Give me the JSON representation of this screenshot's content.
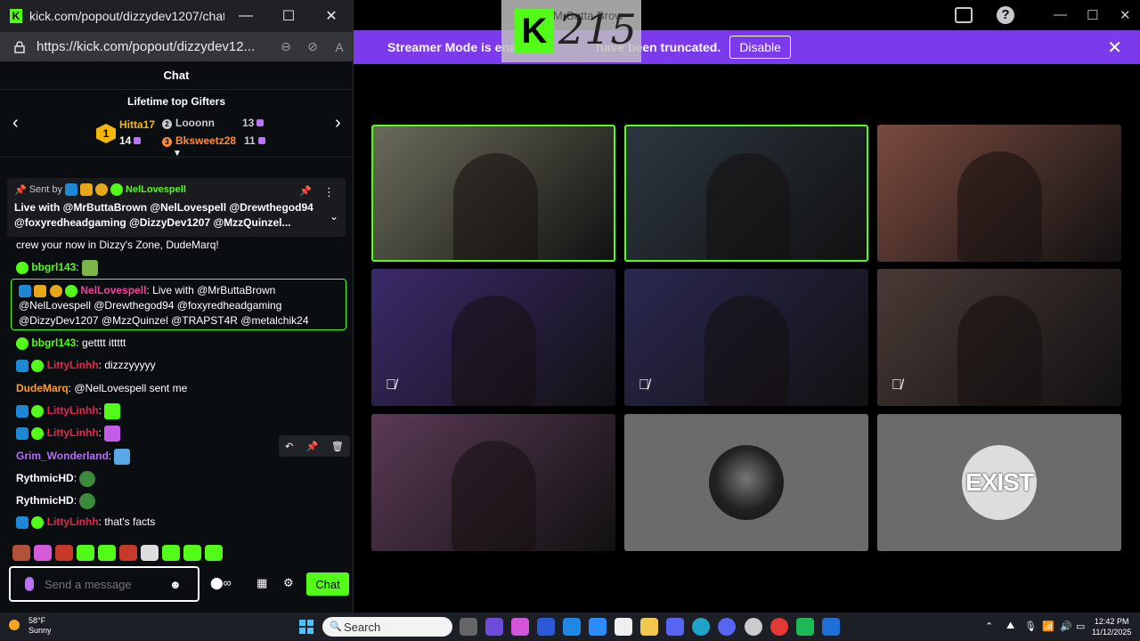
{
  "popout": {
    "title": "kick.com/popout/dizzydev1207/chat -...",
    "url": "https://kick.com/popout/dizzydev12...",
    "chat_header": "Chat",
    "gifters": {
      "title": "Lifetime top Gifters",
      "items": [
        {
          "rank": "1",
          "name": "Hitta17",
          "count": "14",
          "color": "#f5b70a"
        },
        {
          "rank": "2",
          "name": "Looonn",
          "count": "13",
          "color": "#c7c9cc"
        },
        {
          "rank": "3",
          "name": "Bksweetz28",
          "count": "11",
          "color": "#ff8a3d"
        }
      ]
    },
    "pinned": {
      "sent_by_label": "Sent by",
      "sender": "NelLovespell",
      "text": "Live with @MrButtaBrown @NelLovespell @Drewthegod94 @foxyredheadgaming @DizzyDev1207 @MzzQuinzel..."
    },
    "messages": [
      {
        "user": "",
        "text": "crew your now in Dizzy's Zone, DudeMarq!"
      },
      {
        "user": "bbgrl143",
        "text": ":"
      },
      {
        "user": "NelLovespell",
        "text": ": Live with @MrButtaBrown @NelLovespell @Drewthegod94 @foxyredheadgaming @DizzyDev1207 @MzzQuinzel @TRAPST4R @metalchik24"
      },
      {
        "user": "bbgrl143",
        "text": ": getttt ittttt"
      },
      {
        "user": "LittyLinhh",
        "text": ": dizzzyyyyy"
      },
      {
        "user": "DudeMarq",
        "text": ": @NelLovespell sent me"
      },
      {
        "user": "LittyLinhh",
        "text": ":"
      },
      {
        "user": "LittyLinhh",
        "text": ":"
      },
      {
        "user": "Grim_Wonderland",
        "text": ":"
      },
      {
        "user": "RythmicHD",
        "text": ":"
      },
      {
        "user": "RythmicHD",
        "text": ":"
      },
      {
        "user": "LittyLinhh",
        "text": ": that's facts"
      }
    ],
    "input_placeholder": "Send a message",
    "chat_button": "Chat"
  },
  "main": {
    "logo_text": "MrButta Brow",
    "logo_number": "215",
    "banner_text": "Streamer Mode is enabled. Usernames have been truncated.",
    "banner_text_visible": "Streamer Mode is ena                       have been truncated.",
    "disable_label": "Disable",
    "tiles": [
      {
        "id": "tile-1",
        "active": true,
        "muted": false,
        "color": "#6b6b5a"
      },
      {
        "id": "tile-2",
        "active": true,
        "muted": false,
        "color": "#2c3640"
      },
      {
        "id": "tile-3",
        "active": false,
        "muted": false,
        "color": "#7a4a3e"
      },
      {
        "id": "tile-4",
        "active": false,
        "muted": true,
        "color": "#3b2a6b"
      },
      {
        "id": "tile-5",
        "active": false,
        "muted": true,
        "color": "#2a2850"
      },
      {
        "id": "tile-6",
        "active": false,
        "muted": true,
        "color": "#4a3a36"
      },
      {
        "id": "tile-7",
        "active": false,
        "muted": false,
        "color": "#5a3a55"
      },
      {
        "id": "tile-8",
        "active": false,
        "muted": false,
        "color": "#6b6b6b",
        "avatar": "beast"
      },
      {
        "id": "tile-9",
        "active": false,
        "muted": false,
        "color": "#6b6b6b",
        "avatar": "EXIST"
      }
    ]
  },
  "taskbar": {
    "weather_temp": "58°F",
    "weather_desc": "Sunny",
    "search_placeholder": "Search",
    "time": "12:42 PM",
    "date": "11/12/2025"
  },
  "colors": {
    "accent": "#53fc18",
    "banner": "#7c3aed"
  }
}
